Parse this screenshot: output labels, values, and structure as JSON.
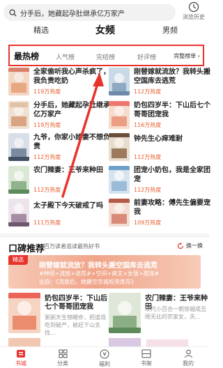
{
  "search": {
    "text": "分手后，她藏起孕肚继承亿万家产",
    "history_label": "浏览历史"
  },
  "top_tabs": [
    {
      "label": "精选",
      "active": false
    },
    {
      "label": "女频",
      "active": true
    },
    {
      "label": "男频",
      "active": false
    }
  ],
  "rank_tabs": [
    {
      "label": "最热榜",
      "active": true
    },
    {
      "label": "人气榜",
      "active": false
    },
    {
      "label": "完结榜",
      "active": false
    },
    {
      "label": "好评榜",
      "active": false
    }
  ],
  "rank_more": "完整榜单 ›",
  "books": [
    {
      "title": "全家偷听我心声杀疯了，我负责吃奶",
      "heat": "119万热度"
    },
    {
      "title": "刚替嫁就流放？我转头搬空国库去逃荒",
      "heat": "112万热度"
    },
    {
      "title": "分手后，她藏起孕肚继承亿万家产",
      "heat": "119万热度"
    },
    {
      "title": "奶包四岁半：下山后七个哥哥团宠我",
      "heat": "116万热度"
    },
    {
      "title": "九爷，你家小娇妻不想负责",
      "heat": "112万热度"
    },
    {
      "title": "钟先生心痒难耐",
      "heat": "112万热度"
    },
    {
      "title": "农门辣妻：王爷来种田",
      "heat": "112万热度"
    },
    {
      "title": "团宠小奶包，我是全家团宠",
      "heat": "112万热度"
    },
    {
      "title": "太子殿下今天破戒了吗",
      "heat": "111万热度"
    },
    {
      "title": "前妻攻略：傅先生偏要宠我",
      "heat": "109万热度"
    }
  ],
  "recommend": {
    "title": "口碑推荐",
    "subtitle": "百万读者追读最热好书",
    "refresh_label": "换一换",
    "banner": {
      "badge": "精选",
      "title": "刚替嫁就流放？我转头搬空国库去逃荒",
      "tags": "#种田+流放+逃荒#+空间+爽文+女强+甜宠#",
      "desc": "出自：《流放后，她搬空京城权贵库存》"
    },
    "books": [
      {
        "title": "奶包四岁半：下山后七个哥哥团宠我",
        "desc": "粥粥天生锦鲤命，把道观吃到破产，被赶下山去找..."
      },
      {
        "title": "农门辣妻：王爷来种田",
        "desc": "现代小百合一朝穿越成丑陋无比的农家女，夫..."
      }
    ]
  },
  "bottom_nav": [
    {
      "label": "书城",
      "active": true
    },
    {
      "label": "分类",
      "active": false
    },
    {
      "label": "福利",
      "active": false
    },
    {
      "label": "书架",
      "active": false
    },
    {
      "label": "我的",
      "active": false
    }
  ],
  "colors": {
    "accent": "#e8332b",
    "heat": "#e85a2a",
    "annotation": "#e8332b"
  }
}
